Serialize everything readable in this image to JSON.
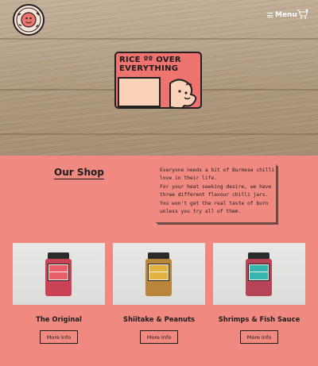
{
  "header": {
    "badge_logo_text": "RICE OVER EVERYTHING",
    "menu_label": "Menu",
    "menu_icon": "hamburger-icon",
    "cart_icon": "cart-icon"
  },
  "hero": {
    "logo_line1": "RICE ºº OVER",
    "logo_line2": "EVERYTHING"
  },
  "shop": {
    "title": "Our Shop",
    "description_lines": [
      "Everyone needs a bit of Burmese chilli",
      "love in their life.",
      "For your heat seeking desire, we have",
      "three different flavour chilli jars.",
      "You won't get the real taste of burn",
      "unless you try all of them."
    ]
  },
  "products": [
    {
      "name": "The Original",
      "button": "More Info",
      "jar_color": "#c94256",
      "label_color": "#e95f67"
    },
    {
      "name": "Shiitake & Peanuts",
      "button": "More Info",
      "jar_color": "#b9853a",
      "label_color": "#e2b23e"
    },
    {
      "name": "Shrimps & Fish Sauce",
      "button": "More Info",
      "jar_color": "#b74456",
      "label_color": "#38b4b0"
    }
  ],
  "colors": {
    "page_bg": "#f08a80",
    "brand_coral": "#ee7470",
    "text_dark": "#1d1d1d"
  }
}
